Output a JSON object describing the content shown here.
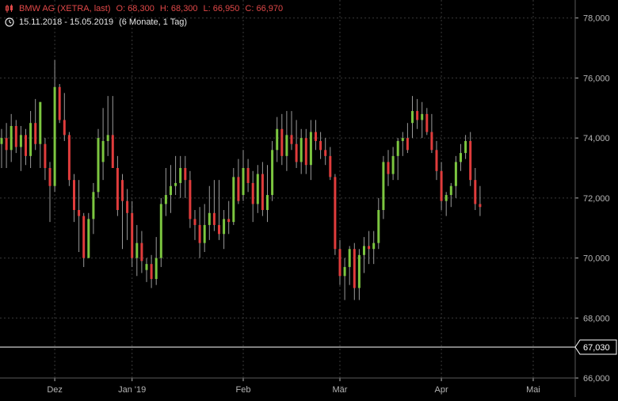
{
  "header": {
    "icon": "candlestick-icon",
    "instrument": "BMW AG (XETRA, last)",
    "open": "O: 68,300",
    "high": "H: 68,300",
    "low": "L: 66,950",
    "close": "C: 66,970",
    "range_icon": "clock-icon",
    "date_range": "15.11.2018 - 15.05.2019",
    "period": "(6 Monate, 1 Tag)"
  },
  "colors": {
    "background": "#000000",
    "up": "#7cc640",
    "down": "#e03c3c",
    "wick": "#9a9a9a",
    "grid": "#3a3a3a",
    "axis_text": "#b4b4b4",
    "last_line": "#ffffff"
  },
  "chart_data": {
    "type": "candlestick",
    "title": "BMW AG (XETRA, last)",
    "ylim": [
      66,
      78.6
    ],
    "y_ticks": [
      66,
      68,
      70,
      72,
      74,
      76,
      78
    ],
    "y_tick_labels": [
      "66,000",
      "68,000",
      "70,000",
      "72,000",
      "74,000",
      "76,000",
      "78,000"
    ],
    "x_labels": [
      {
        "label": "Dez",
        "index": 11
      },
      {
        "label": "Jan '19",
        "index": 27
      },
      {
        "label": "Feb",
        "index": 50
      },
      {
        "label": "Mär",
        "index": 70
      },
      {
        "label": "Apr",
        "index": 91
      },
      {
        "label": "Mai",
        "index": 110
      }
    ],
    "last_price": 67.03,
    "last_price_label": "67,030",
    "grid": true,
    "candles": [
      [
        73.8,
        74.3,
        73.0,
        74.0
      ],
      [
        74.0,
        74.5,
        73.0,
        73.6
      ],
      [
        73.6,
        74.8,
        73.2,
        74.4
      ],
      [
        74.4,
        74.6,
        73.5,
        73.7
      ],
      [
        73.7,
        74.4,
        72.9,
        74.1
      ],
      [
        74.1,
        74.3,
        73.1,
        73.4
      ],
      [
        73.4,
        74.9,
        73.0,
        74.5
      ],
      [
        74.5,
        75.3,
        73.6,
        73.8
      ],
      [
        73.8,
        75.2,
        73.0,
        75.2
      ],
      [
        73.8,
        74.0,
        72.6,
        73.0
      ],
      [
        73.0,
        73.2,
        71.2,
        72.4
      ],
      [
        72.4,
        76.6,
        72.2,
        75.7
      ],
      [
        75.7,
        75.8,
        74.5,
        74.6
      ],
      [
        74.6,
        75.5,
        73.9,
        74.1
      ],
      [
        74.1,
        74.2,
        72.4,
        72.6
      ],
      [
        72.6,
        72.8,
        71.2,
        71.6
      ],
      [
        71.6,
        72.6,
        70.2,
        71.4
      ],
      [
        71.4,
        71.5,
        69.7,
        70.0
      ],
      [
        70.0,
        71.5,
        70.0,
        71.3
      ],
      [
        71.3,
        72.5,
        70.8,
        72.2
      ],
      [
        72.2,
        74.3,
        72.0,
        74.0
      ],
      [
        73.2,
        75.0,
        72.6,
        73.9
      ],
      [
        73.9,
        75.4,
        73.4,
        74.1
      ],
      [
        74.1,
        75.4,
        73.0,
        73.0
      ],
      [
        73.0,
        73.4,
        71.4,
        71.6
      ],
      [
        72.6,
        72.8,
        70.3,
        71.9
      ],
      [
        71.9,
        72.3,
        70.6,
        71.5
      ],
      [
        71.5,
        71.9,
        69.7,
        70.0
      ],
      [
        70.0,
        71.1,
        69.4,
        70.5
      ],
      [
        70.5,
        70.9,
        69.5,
        69.9
      ],
      [
        69.6,
        70.0,
        69.2,
        69.8
      ],
      [
        69.8,
        70.1,
        69.0,
        69.3
      ],
      [
        69.3,
        70.7,
        69.1,
        70.0
      ],
      [
        70.0,
        72.0,
        69.7,
        71.8
      ],
      [
        71.8,
        73.0,
        71.4,
        72.1
      ],
      [
        72.1,
        73.1,
        71.5,
        72.4
      ],
      [
        72.4,
        73.4,
        72.1,
        72.5
      ],
      [
        72.5,
        73.4,
        72.0,
        73.0
      ],
      [
        73.0,
        73.4,
        72.0,
        72.6
      ],
      [
        72.6,
        72.9,
        71.0,
        71.3
      ],
      [
        71.3,
        71.6,
        70.6,
        71.1
      ],
      [
        71.1,
        71.7,
        70.0,
        70.5
      ],
      [
        70.5,
        71.8,
        70.2,
        71.1
      ],
      [
        71.1,
        72.4,
        70.6,
        71.5
      ],
      [
        71.5,
        72.6,
        70.9,
        71.1
      ],
      [
        71.1,
        72.6,
        70.6,
        70.8
      ],
      [
        70.8,
        71.6,
        70.3,
        71.3
      ],
      [
        71.3,
        71.9,
        70.8,
        71.2
      ],
      [
        71.2,
        73.0,
        71.1,
        72.7
      ],
      [
        72.7,
        73.3,
        71.8,
        71.9
      ],
      [
        72.1,
        73.6,
        71.9,
        73.0
      ],
      [
        73.0,
        73.3,
        72.2,
        72.5
      ],
      [
        72.5,
        72.9,
        71.2,
        71.8
      ],
      [
        71.8,
        73.1,
        71.5,
        72.8
      ],
      [
        72.8,
        73.2,
        71.4,
        71.6
      ],
      [
        71.6,
        73.1,
        71.2,
        72.1
      ],
      [
        72.1,
        73.9,
        71.9,
        73.6
      ],
      [
        73.6,
        74.7,
        73.2,
        74.3
      ],
      [
        74.3,
        74.8,
        73.1,
        73.4
      ],
      [
        73.4,
        74.9,
        72.9,
        74.1
      ],
      [
        74.1,
        74.9,
        73.6,
        73.8
      ],
      [
        73.8,
        74.6,
        73.0,
        73.2
      ],
      [
        73.2,
        74.3,
        72.8,
        74.0
      ],
      [
        74.0,
        74.3,
        72.8,
        73.1
      ],
      [
        73.1,
        74.6,
        72.6,
        74.2
      ],
      [
        74.2,
        74.6,
        73.6,
        73.9
      ],
      [
        73.9,
        74.2,
        73.3,
        73.6
      ],
      [
        73.6,
        74.0,
        73.1,
        73.4
      ],
      [
        73.4,
        73.7,
        72.6,
        72.7
      ],
      [
        72.7,
        72.8,
        70.1,
        70.3
      ],
      [
        70.3,
        70.6,
        69.1,
        69.4
      ],
      [
        69.4,
        70.0,
        68.6,
        69.7
      ],
      [
        69.7,
        70.4,
        69.1,
        70.3
      ],
      [
        70.3,
        70.5,
        68.6,
        69.0
      ],
      [
        69.0,
        70.3,
        68.6,
        70.1
      ],
      [
        70.1,
        70.7,
        69.5,
        70.4
      ],
      [
        70.4,
        70.9,
        69.8,
        70.3
      ],
      [
        70.3,
        70.9,
        69.8,
        70.5
      ],
      [
        70.5,
        72.0,
        70.3,
        71.6
      ],
      [
        71.6,
        73.4,
        71.3,
        73.2
      ],
      [
        73.2,
        73.6,
        72.4,
        72.8
      ],
      [
        72.8,
        73.7,
        72.6,
        73.4
      ],
      [
        73.4,
        74.0,
        72.6,
        73.9
      ],
      [
        73.9,
        74.2,
        73.4,
        74.0
      ],
      [
        74.0,
        74.5,
        73.5,
        73.6
      ],
      [
        74.5,
        75.4,
        74.0,
        74.9
      ],
      [
        74.9,
        75.3,
        74.3,
        74.6
      ],
      [
        74.6,
        75.2,
        74.0,
        74.8
      ],
      [
        74.8,
        75.0,
        74.1,
        74.2
      ],
      [
        74.2,
        74.8,
        73.5,
        73.6
      ],
      [
        73.6,
        73.9,
        72.6,
        72.9
      ],
      [
        72.9,
        73.2,
        71.6,
        71.9
      ],
      [
        71.9,
        72.2,
        71.4,
        72.1
      ],
      [
        72.1,
        72.5,
        71.7,
        72.4
      ],
      [
        72.4,
        73.4,
        72.0,
        73.2
      ],
      [
        73.2,
        73.8,
        72.9,
        73.5
      ],
      [
        73.5,
        74.1,
        73.3,
        73.9
      ],
      [
        73.9,
        74.2,
        72.4,
        72.6
      ],
      [
        72.6,
        73.0,
        71.6,
        71.8
      ],
      [
        71.8,
        72.4,
        71.4,
        71.7
      ]
    ]
  }
}
